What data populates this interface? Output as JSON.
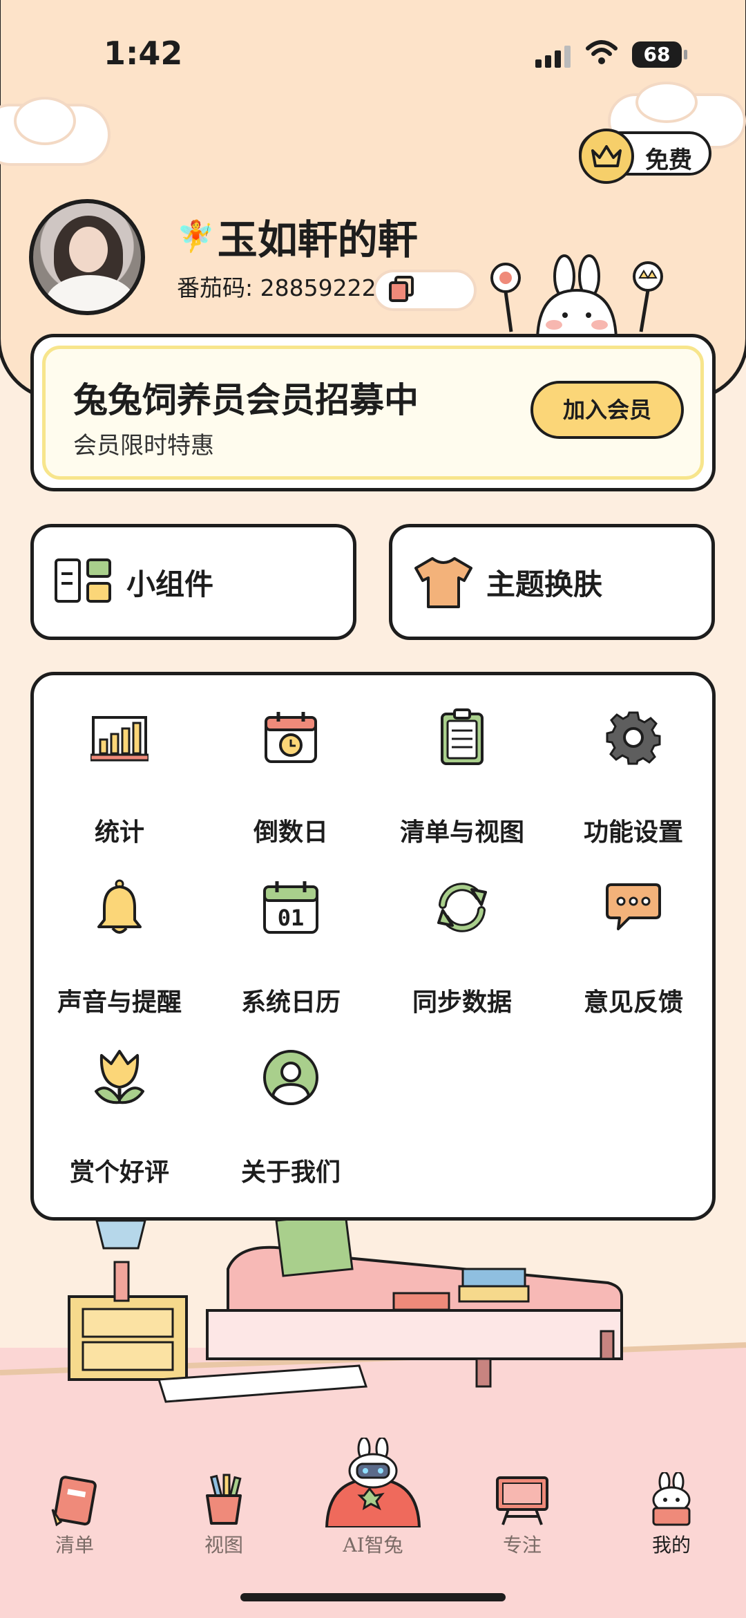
{
  "status_bar": {
    "time": "1:42",
    "battery": "68"
  },
  "header": {
    "free_label": "免费"
  },
  "profile": {
    "name": "玉如軒的軒",
    "code": "番茄码: 28859222"
  },
  "membership": {
    "title": "兔兔饲养员会员招募中",
    "subtitle": "会员限时特惠",
    "join_label": "加入会员"
  },
  "quick_cards": {
    "widget_label": "小组件",
    "theme_label": "主题换肤"
  },
  "menu": [
    {
      "label": "统计",
      "icon": "bar-chart-icon"
    },
    {
      "label": "倒数日",
      "icon": "calendar-clock-icon"
    },
    {
      "label": "清单与视图",
      "icon": "clipboard-list-icon"
    },
    {
      "label": "功能设置",
      "icon": "gear-icon"
    },
    {
      "label": "声音与提醒",
      "icon": "bell-icon"
    },
    {
      "label": "系统日历",
      "icon": "calendar-icon"
    },
    {
      "label": "同步数据",
      "icon": "sync-icon"
    },
    {
      "label": "意见反馈",
      "icon": "chat-bubble-icon"
    },
    {
      "label": "赏个好评",
      "icon": "tulip-icon"
    },
    {
      "label": "关于我们",
      "icon": "user-circle-icon"
    }
  ],
  "calendar_icon_text": "01",
  "tabs": [
    {
      "label": "清单"
    },
    {
      "label": "视图"
    },
    {
      "label": "AI智兔"
    },
    {
      "label": "专注"
    },
    {
      "label": "我的"
    }
  ],
  "colors": {
    "header_bg": "#fde3c9",
    "accent_yellow": "#fbd678",
    "accent_green": "#a9cf8c",
    "accent_red": "#ef8a7a"
  }
}
